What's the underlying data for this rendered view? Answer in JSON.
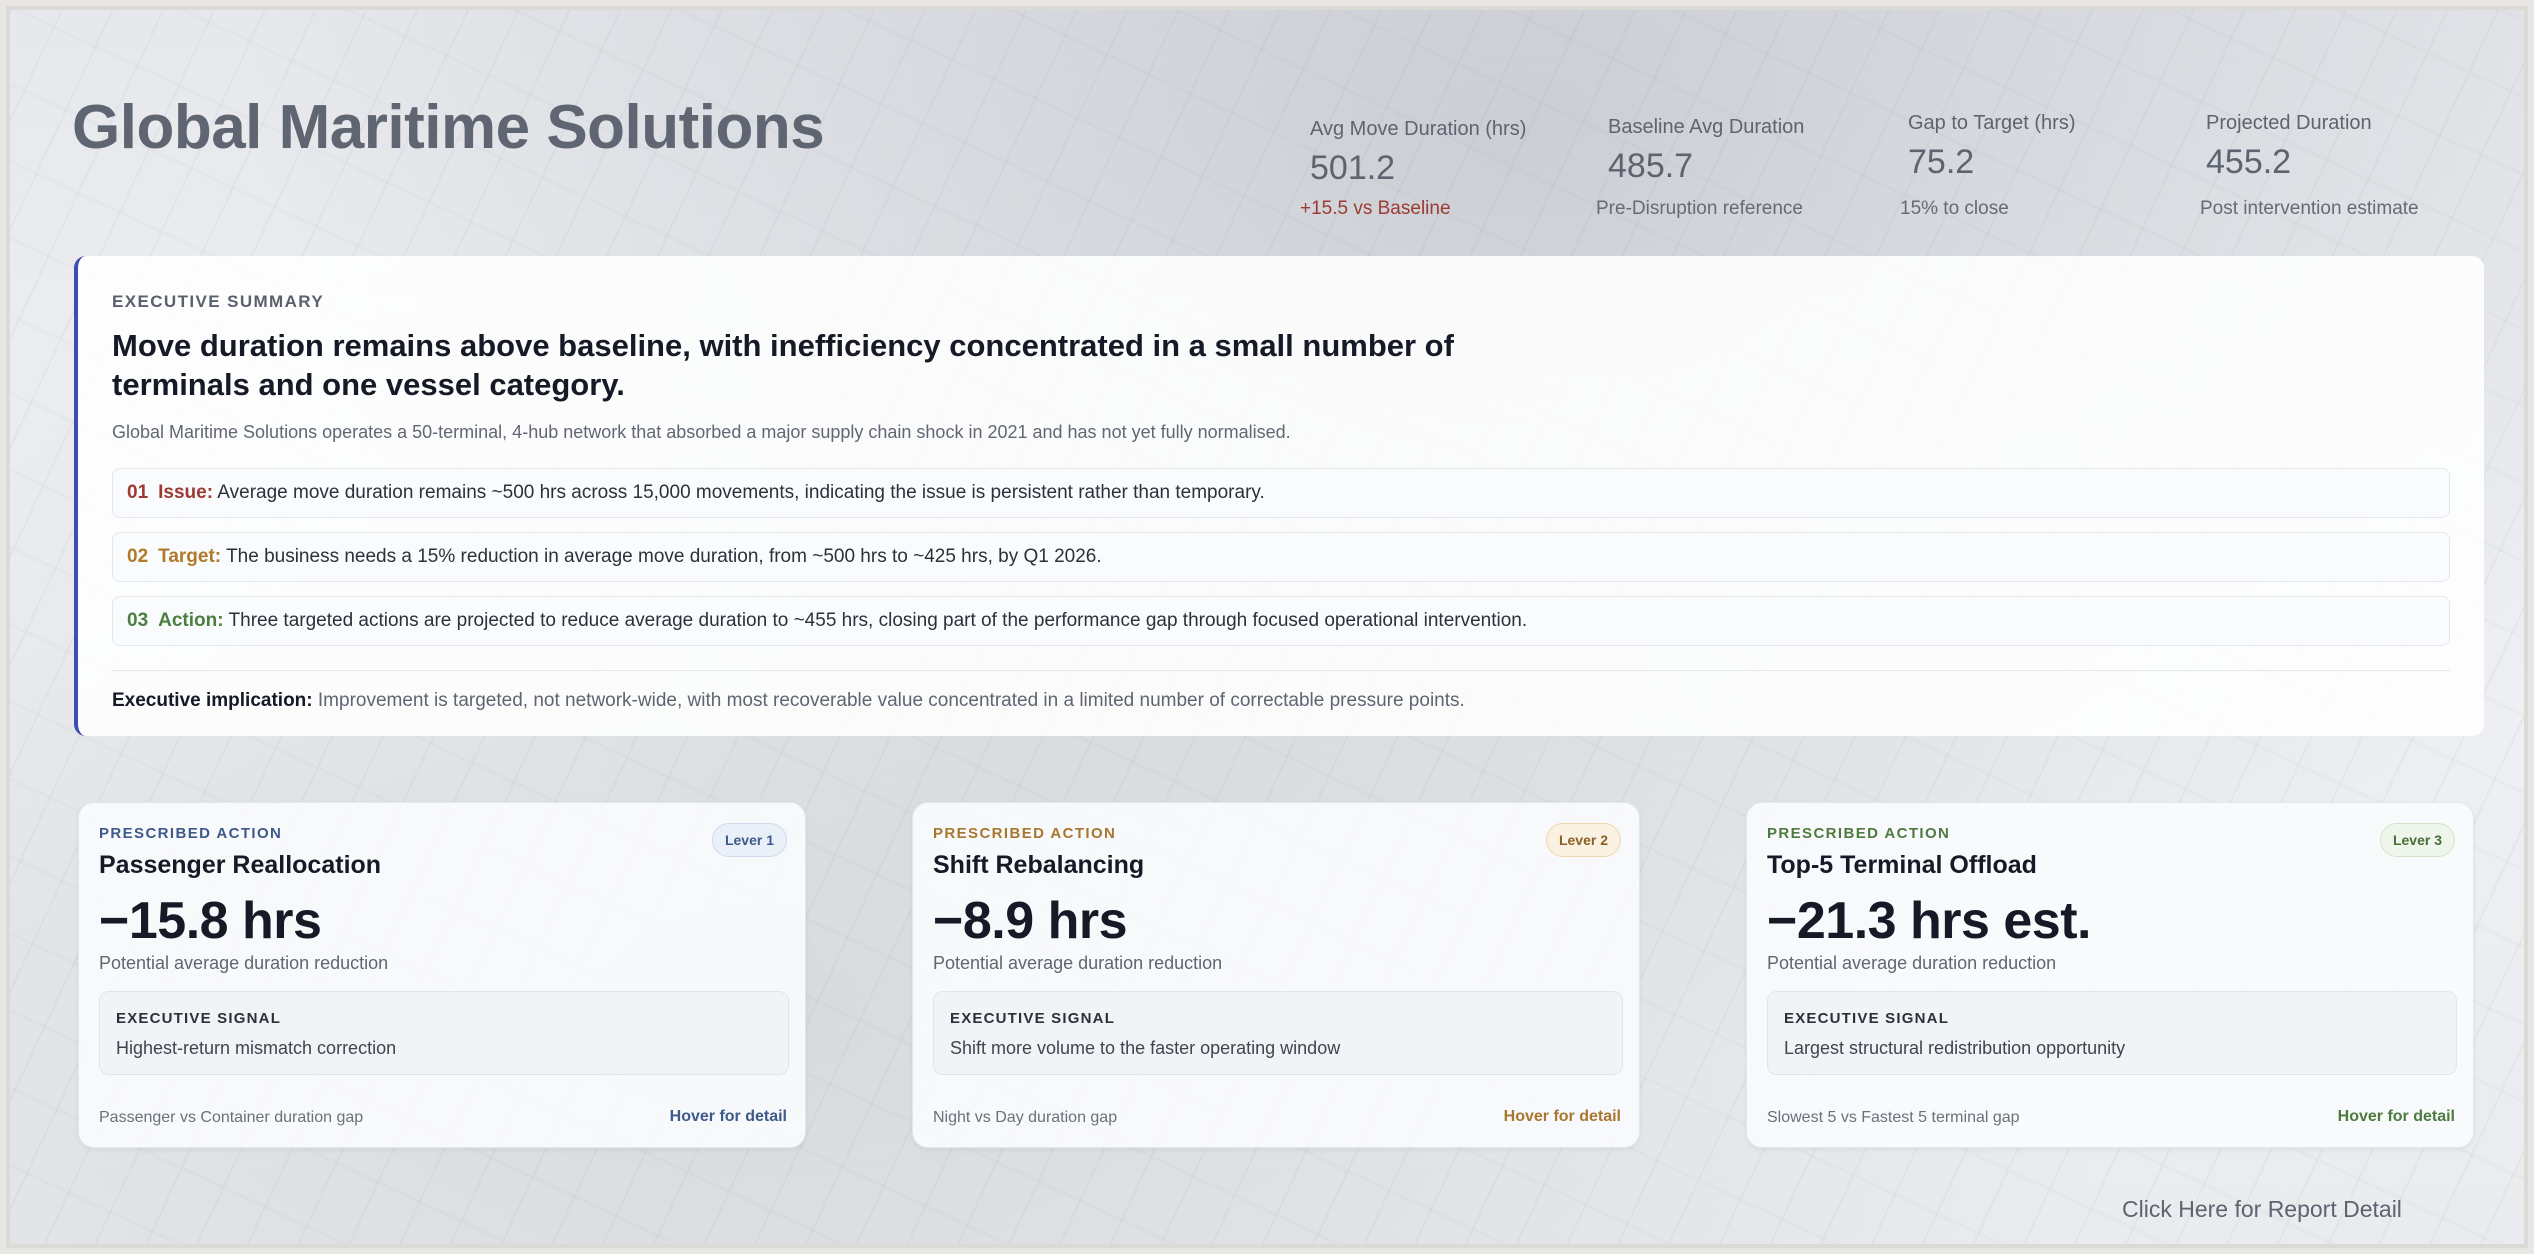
{
  "title": "Global Maritime Solutions",
  "kpis": [
    {
      "label": "Avg Move Duration (hrs)",
      "value": "501.2",
      "sub": "+15.5 vs Baseline"
    },
    {
      "label": "Baseline Avg Duration",
      "value": "485.7",
      "sub": "Pre-Disruption reference"
    },
    {
      "label": "Gap to Target (hrs)",
      "value": "75.2",
      "sub": "15% to close"
    },
    {
      "label": "Projected Duration",
      "value": "455.2",
      "sub": "Post intervention estimate"
    }
  ],
  "summary": {
    "eyebrow": "EXECUTIVE SUMMARY",
    "headline": "Move duration remains above baseline, with inefficiency concentrated in a small number of terminals and one vessel category.",
    "intro": "Global Maritime Solutions operates a 50-terminal, 4-hub network that absorbed a major supply chain shock in 2021 and has not yet fully normalised.",
    "points": [
      {
        "num": "01",
        "tag": "Issue:",
        "text": "Average move duration remains ~500 hrs across 15,000 movements, indicating the issue is persistent rather than temporary."
      },
      {
        "num": "02",
        "tag": "Target:",
        "text": "The business needs a 15% reduction in average move duration, from ~500 hrs to ~425 hrs, by Q1 2026."
      },
      {
        "num": "03",
        "tag": "Action:",
        "text": "Three targeted actions are projected to reduce average duration to ~455 hrs, closing part of the performance gap through focused operational intervention."
      }
    ],
    "implication_label": "Executive implication:",
    "implication_text": "Improvement is targeted, not network-wide, with most recoverable value concentrated in a limited number of correctable pressure points."
  },
  "cards": [
    {
      "eyebrow": "PRESCRIBED ACTION",
      "badge": "Lever 1",
      "name": "Passenger Reallocation",
      "value": "−15.8 hrs",
      "desc": "Potential average duration reduction",
      "signal_title": "EXECUTIVE SIGNAL",
      "signal_text": "Highest-return mismatch correction",
      "footer": "Passenger vs Container duration gap",
      "hover": "Hover for detail"
    },
    {
      "eyebrow": "PRESCRIBED ACTION",
      "badge": "Lever 2",
      "name": "Shift Rebalancing",
      "value": "−8.9 hrs",
      "desc": "Potential average duration reduction",
      "signal_title": "EXECUTIVE SIGNAL",
      "signal_text": "Shift more volume to the faster operating window",
      "footer": "Night vs Day duration gap",
      "hover": "Hover for detail"
    },
    {
      "eyebrow": "PRESCRIBED ACTION",
      "badge": "Lever 3",
      "name": "Top-5 Terminal Offload",
      "value": "−21.3 hrs est.",
      "desc": "Potential average duration reduction",
      "signal_title": "EXECUTIVE SIGNAL",
      "signal_text": "Largest structural redistribution opportunity",
      "footer": "Slowest 5 vs Fastest 5 terminal gap",
      "hover": "Hover for detail"
    }
  ],
  "report_link": "Click Here for Report Detail",
  "colors": {
    "accent": "#3f4cb0",
    "issue": "#9b3b32",
    "target": "#b07a2b",
    "action": "#4a7f3f"
  }
}
